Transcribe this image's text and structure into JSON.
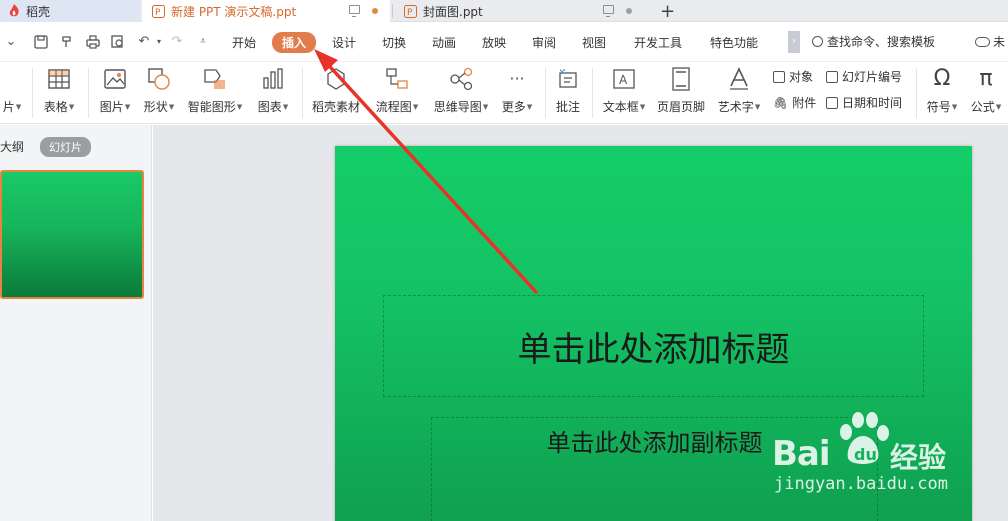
{
  "tabs": {
    "daoke": "稻壳",
    "active": "新建 PPT 演示文稿.ppt",
    "cover": "封面图.ppt"
  },
  "menu": {
    "items": [
      "开始",
      "插入",
      "设计",
      "切换",
      "动画",
      "放映",
      "审阅",
      "视图",
      "开发工具",
      "特色功能"
    ],
    "selected": "插入",
    "search_label": "查找命令、搜索模板",
    "cloud_label": "未"
  },
  "ribbon": {
    "picture_partial": "片",
    "table": "表格",
    "image": "图片",
    "shape": "形状",
    "smart_art": "智能图形",
    "chart": "图表",
    "daoke_material": "稻壳素材",
    "flowchart": "流程图",
    "mindmap": "思维导图",
    "more": "更多",
    "comment": "批注",
    "textbox": "文本框",
    "header_footer": "页眉页脚",
    "wordart": "艺术字",
    "object": "对象",
    "attachment": "附件",
    "slide_number": "幻灯片编号",
    "datetime": "日期和时间",
    "symbol": "符号",
    "formula": "公式"
  },
  "left_pane": {
    "outline_tab": "大纲",
    "slides_tab": "幻灯片"
  },
  "slide": {
    "title_placeholder": "单击此处添加标题",
    "subtitle_placeholder": "单击此处添加副标题"
  },
  "watermark": {
    "brand": "Bai",
    "brand_cn": "经验",
    "url": "jingyan.baidu.com"
  },
  "colors": {
    "accent": "#e17c4d",
    "slide_green": "#14cd68",
    "annotation_arrow": "#e8332a"
  }
}
